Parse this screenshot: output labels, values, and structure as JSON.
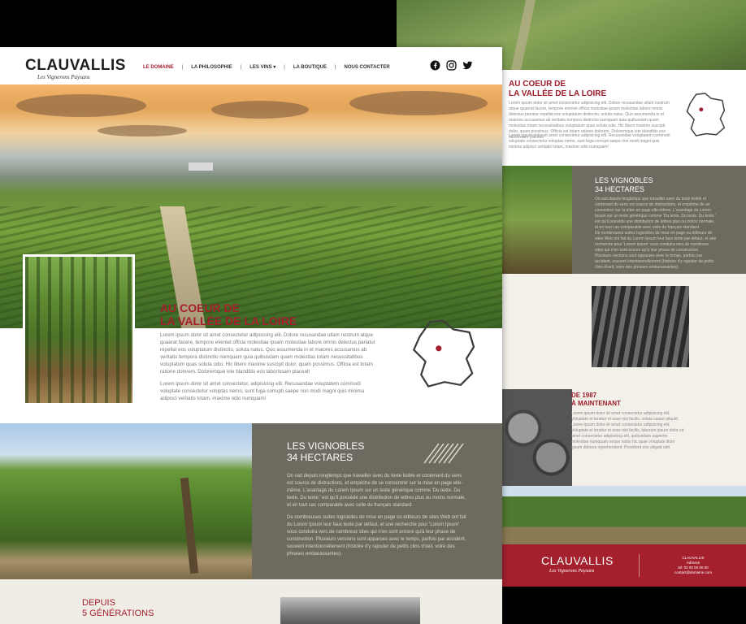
{
  "nav": {
    "logo": "CLAUVALLIS",
    "tagline": "Les Vignerons Paysans",
    "items": [
      {
        "label": "LE DOMAINE",
        "active": true
      },
      {
        "label": "LA PHILOSOPHIE",
        "active": false
      },
      {
        "label": "LES VINS ▾",
        "active": false
      },
      {
        "label": "LA BOUTIQUE",
        "active": false
      },
      {
        "label": "NOUS CONTACTER",
        "active": false
      }
    ],
    "separator": "|",
    "socials": [
      "facebook-icon",
      "instagram-icon",
      "twitter-icon"
    ]
  },
  "about": {
    "title": "AU COEUR DE\nLA VALLÉE DE LA LOIRE",
    "p1": "Lorem ipsum dolor sit amet consectetur adipisicing elit. Dolore recusandae ullam nostrum atque quaerat facere, tempore eveniet officia molestiae ipsam molestiae labore omnis delectus pariatur repellat eos voluptatum distinctio, soluta natus. Quo assumenda in et maiores accusamus ab veritatis tempora distinctio numquam quia quibusdam quam molestias totam necessitatibus voluptatum quas soluta odio. Hic libero maxime suscipit dolor, quam possimus. Officia est totam ratione dolorem. Doloremque iste blanditiis eos laboriosam placeat!",
    "p2": "Lorem ipsum dolor sit amet consectetur, adipisicing elit. Recusandae voluptatem commodi voluptate consectetur voluptas nemo, sunt fuga corrupti saepe non modi magni quis minima adipisci veritatis totam, maxime odio numquam!"
  },
  "vineyards": {
    "title": "LES VIGNOBLES\n34 HECTARES",
    "p1": "On sait depuis longtemps que travailler avec du texte lisible et contenant du sens est source de distractions, et empêche de se concentrer sur la mise en page elle-même. L'avantage du Lorem Ipsum sur un texte générique comme 'Du texte. Du texte. Du texte.' est qu'il possède une distribution de lettres plus ou moins normale, et en tout cas comparable avec celle du français standard.",
    "p2": "De nombreuses suites logicielles de mise en page ou éditeurs de sites Web ont fait du Lorem Ipsum leur faux texte par défaut, et une recherche pour 'Lorem Ipsum' vous conduira vers de nombreux sites qui n'en sont encore qu'à leur phase de construction. Plusieurs versions sont apparues avec le temps, parfois par accident, souvent intentionnellement (histoire d'y rajouter de petits clins d'oeil, voire des phrases embarassantes)."
  },
  "generations": {
    "title": "DEPUIS\n5 GÉNÉRATIONS"
  },
  "back": {
    "title": "AU COEUR DE\nLA VALLÉE DE LA LOIRE",
    "p1": "Lorem ipsum dolor sit amet consectetur adipisicing elit. Dolore recusandae ullam nostrum atque quaerat facere, tempore eveniet officia molestiae ipsam molestiae labore omnis delectus pariatur repellat eos voluptatum distinctio, soluta natus. Quo assumenda in et maiores accusamus ab veritatis tempora distinctio numquam quia quibusdam quam molestias totam necessitatibus voluptatum quas soluta odio. Hic libero maxime suscipit dolor, quam possimus. Officia est totam ratione dolorem. Doloremque iste blanditiis eos laboriosam placeat!",
    "p2": "Lorem ipsum dolor sit amet consectetur adipisicing elit. Recusandae voluptatem commodi voluptate consectetur voluptas nemo, sunt fuga corrupti saepe non modi magni quis minima adipisci veritatis totam, maxime odio numquam!",
    "vine_title": "LES VIGNOBLES\n34 HECTARES",
    "vine_p1": "On sait depuis longtemps que travailler avec du texte lisible et contenant du sens est source de distractions, et empêche de se concentrer sur la mise en page elle-même. L'avantage du Lorem Ipsum sur un texte générique comme 'Du texte. Du texte. Du texte.' est qu'il possède une distribution de lettres plus ou moins normale, et en tout cas comparable avec celle du français standard.",
    "vine_p2": "De nombreuses suites logicielles de mise en page ou éditeurs de sites Web ont fait du Lorem Ipsum leur faux texte par défaut, et une recherche pour 'Lorem Ipsum' vous conduira vers de nombreux sites qui n'en sont encore qu'à leur phase de construction. Plusieurs versions sont apparues avec le temps, parfois par accident, souvent intentionnellement (histoire d'y rajouter de petits clins d'oeil, voire des phrases embarassantes).",
    "history_title": "DE 1987\nÀ MAINTENANT",
    "history_p": "Lorem ipsum dolor sit amet consectetur adipisicing elit. Voluptate et tenetur et esse nisi facilis, soluta saepe aliquid. Lorem ipsum dolor sit amet consectetur adipisicing elit. Voluptate et tenetur et esse nisi facilis, laborum ipsum dolor sit amet consectetur adipisicing elit, quibusdam sapiente molestiae numquam neque nobis hic quae voluptate illum ipsum dolores reprehenderit. Provident eos aliquid odit.",
    "footer_logo": "CLAUVALLIS",
    "footer_tagline": "Les Vignerons Paysans",
    "footer_info": "CLAUVALLIS\nAdresse\ntel: 02 00 00 00 00\ncontact@domaine.com"
  },
  "colors": {
    "brand_red": "#a4202d",
    "panel_taupe": "#6e6a5f",
    "cream": "#f0ede7"
  }
}
